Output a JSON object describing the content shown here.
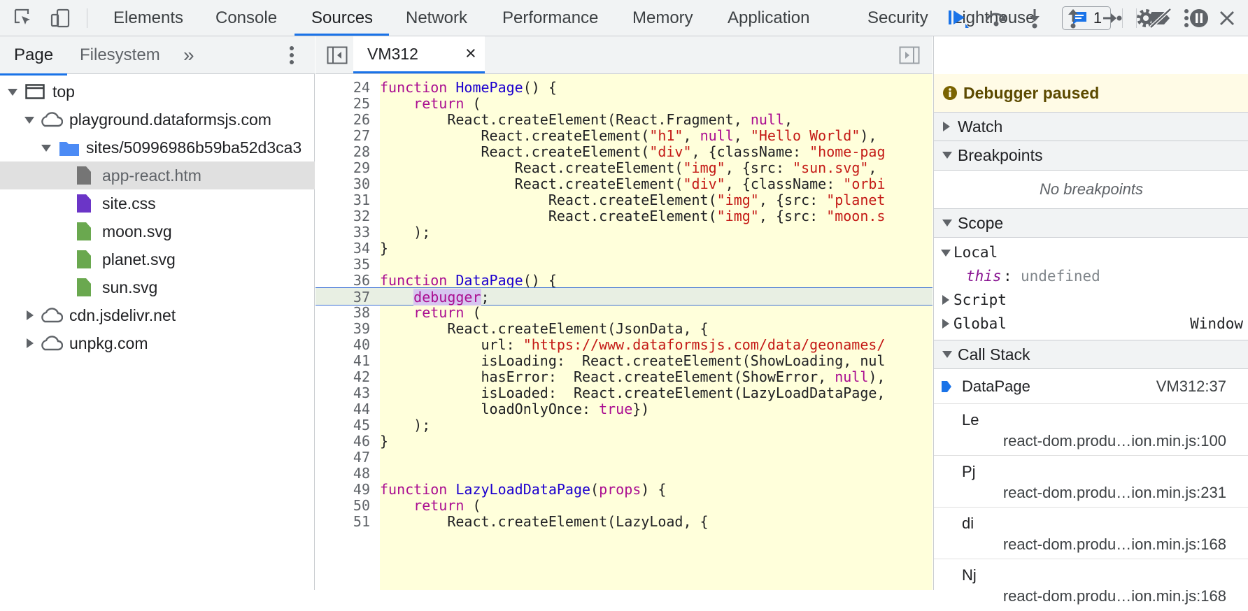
{
  "toolbar": {
    "tabs": [
      "Elements",
      "Console",
      "Sources",
      "Network",
      "Performance",
      "Memory",
      "Application",
      "Security",
      "Lighthouse"
    ],
    "active_tab": "Sources",
    "issues_count": "1"
  },
  "navigator": {
    "tabs": [
      "Page",
      "Filesystem"
    ],
    "more": "»",
    "tree": [
      {
        "label": "top"
      },
      {
        "label": "playground.dataformsjs.com"
      },
      {
        "label": "sites/50996986b59ba52d3ca3"
      },
      {
        "label": "app-react.htm"
      },
      {
        "label": "site.css"
      },
      {
        "label": "moon.svg"
      },
      {
        "label": "planet.svg"
      },
      {
        "label": "sun.svg"
      },
      {
        "label": "cdn.jsdelivr.net"
      },
      {
        "label": "unpkg.com"
      }
    ]
  },
  "editor": {
    "tab_label": "VM312",
    "close": "×",
    "lines": [
      {
        "n": "24",
        "text": "function HomePage() {"
      },
      {
        "n": "25",
        "text": "    return ("
      },
      {
        "n": "26",
        "text": "        React.createElement(React.Fragment, null,"
      },
      {
        "n": "27",
        "text": "            React.createElement(\"h1\", null, \"Hello World\"),"
      },
      {
        "n": "28",
        "text": "            React.createElement(\"div\", {className: \"home-pag"
      },
      {
        "n": "29",
        "text": "                React.createElement(\"img\", {src: \"sun.svg\","
      },
      {
        "n": "30",
        "text": "                React.createElement(\"div\", {className: \"orbi"
      },
      {
        "n": "31",
        "text": "                    React.createElement(\"img\", {src: \"planet"
      },
      {
        "n": "32",
        "text": "                    React.createElement(\"img\", {src: \"moon.s"
      },
      {
        "n": "33",
        "text": "    );"
      },
      {
        "n": "34",
        "text": "}"
      },
      {
        "n": "35",
        "text": ""
      },
      {
        "n": "36",
        "text": "function DataPage() {"
      },
      {
        "n": "37",
        "text": "    debugger;"
      },
      {
        "n": "38",
        "text": "    return ("
      },
      {
        "n": "39",
        "text": "        React.createElement(JsonData, {"
      },
      {
        "n": "40",
        "text": "            url: \"https://www.dataformsjs.com/data/geonames/"
      },
      {
        "n": "41",
        "text": "            isLoading:  React.createElement(ShowLoading, nul"
      },
      {
        "n": "42",
        "text": "            hasError:  React.createElement(ShowError, null),"
      },
      {
        "n": "43",
        "text": "            isLoaded:  React.createElement(LazyLoadDataPage,"
      },
      {
        "n": "44",
        "text": "            loadOnlyOnce: true})"
      },
      {
        "n": "45",
        "text": "    );"
      },
      {
        "n": "46",
        "text": "}"
      },
      {
        "n": "47",
        "text": ""
      },
      {
        "n": "48",
        "text": ""
      },
      {
        "n": "49",
        "text": "function LazyLoadDataPage(props) {"
      },
      {
        "n": "50",
        "text": "    return ("
      },
      {
        "n": "51",
        "text": "        React.createElement(LazyLoad, {"
      }
    ]
  },
  "debugger": {
    "paused_label": "Debugger paused",
    "watch": "Watch",
    "breakpoints": "Breakpoints",
    "no_breakpoints": "No breakpoints",
    "scope": "Scope",
    "local": "Local",
    "this_key": "this",
    "this_value": "undefined",
    "script": "Script",
    "global": "Global",
    "global_value": "Window",
    "call_stack": "Call Stack",
    "frames": [
      {
        "name": "DataPage",
        "loc": "VM312:37"
      },
      {
        "name": "Le",
        "loc": "react-dom.produ…ion.min.js:100"
      },
      {
        "name": "Pj",
        "loc": "react-dom.produ…ion.min.js:231"
      },
      {
        "name": "di",
        "loc": "react-dom.produ…ion.min.js:168"
      },
      {
        "name": "Nj",
        "loc": "react-dom.produ…ion.min.js:168"
      }
    ]
  },
  "colors": {
    "accent": "#1a73e8",
    "paused_bg": "#fffbe6",
    "code_bg": "#ffffdb"
  }
}
